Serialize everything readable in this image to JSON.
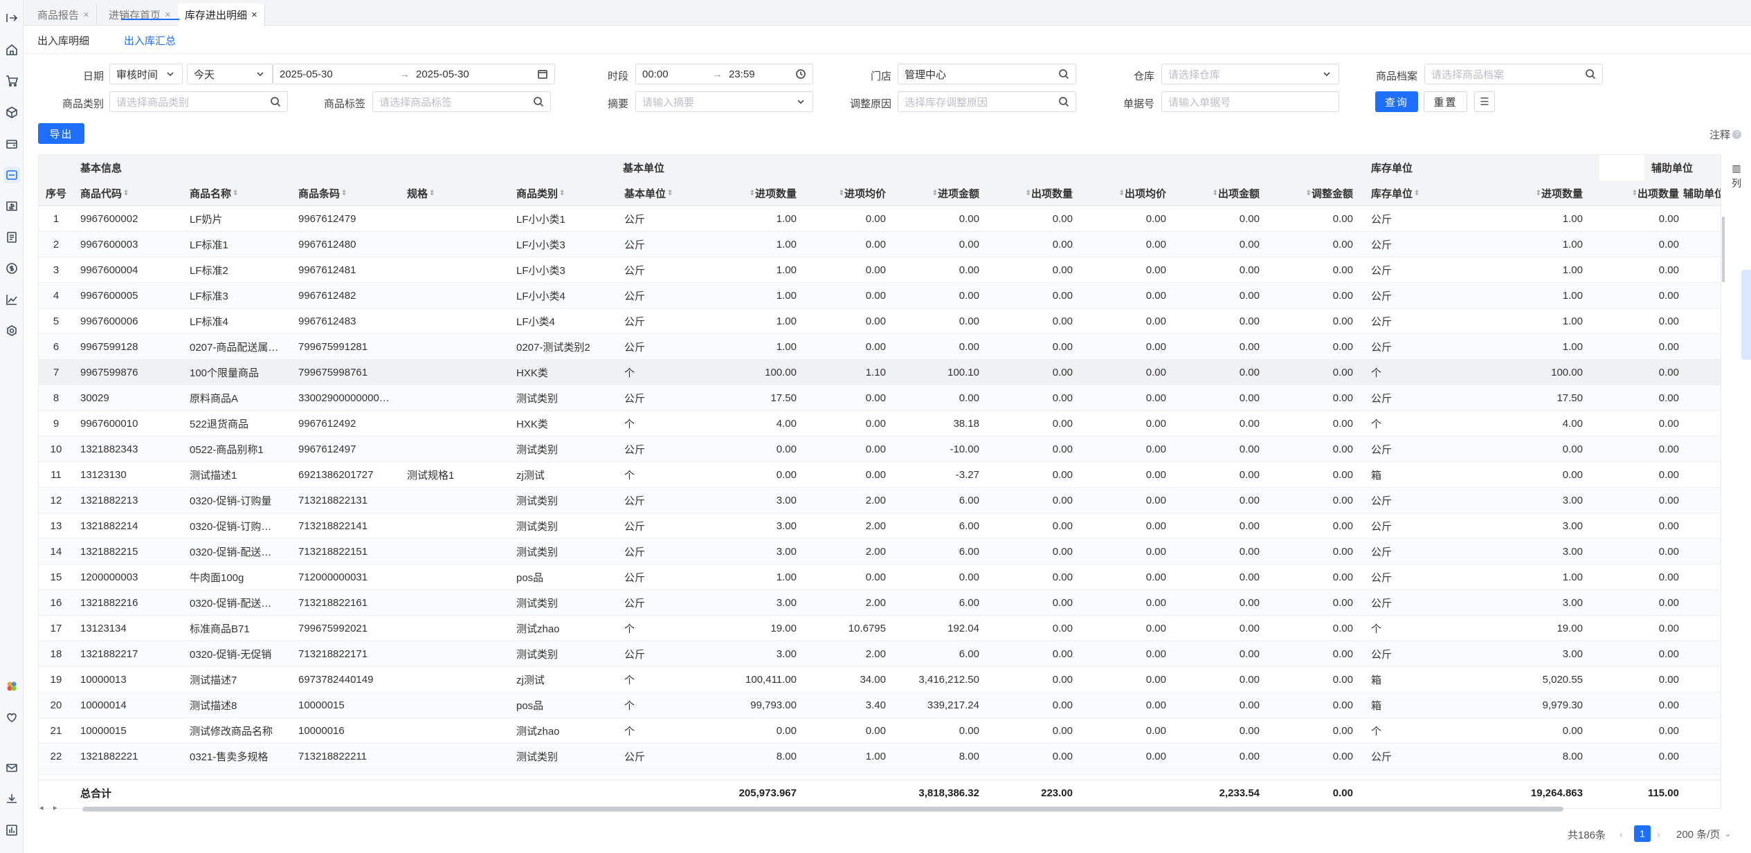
{
  "page_tabs": [
    {
      "label": "商品报告",
      "active": false
    },
    {
      "label": "进销存首页",
      "active": false
    },
    {
      "label": "库存进出明细",
      "active": true
    }
  ],
  "sub_tabs": [
    {
      "label": "出入库明细",
      "active": false
    },
    {
      "label": "出入库汇总",
      "active": true
    }
  ],
  "filters": {
    "date_label": "日期",
    "date_type": "审核时间",
    "date_range": "今天",
    "date_start": "2025-05-30",
    "date_end": "2025-05-30",
    "period_label": "时段",
    "time_start": "00:00",
    "time_end": "23:59",
    "store_label": "门店",
    "store_value": "管理中心",
    "warehouse_label": "仓库",
    "warehouse_placeholder": "请选择仓库",
    "product_file_label": "商品档案",
    "product_file_placeholder": "请选择商品档案",
    "category_label": "商品类别",
    "category_placeholder": "请选择商品类别",
    "tag_label": "商品标签",
    "tag_placeholder": "请选择商品标签",
    "summary_label": "摘要",
    "summary_placeholder": "请输入摘要",
    "reason_label": "调整原因",
    "reason_placeholder": "选择库存调整原因",
    "docno_label": "单据号",
    "docno_placeholder": "请输入单据号",
    "query_label": "查询",
    "reset_label": "重置"
  },
  "export_label": "导出",
  "note_label": "注释",
  "group_headers": {
    "basic_info": "基本信息",
    "basic_unit": "基本单位",
    "stock_unit": "库存单位",
    "aux_unit": "辅助单位"
  },
  "columns": [
    "序号",
    "商品代码",
    "商品名称",
    "商品条码",
    "规格",
    "商品类别",
    "基本单位",
    "进项数量",
    "进项均价",
    "进项金额",
    "出项数量",
    "出项均价",
    "出项金额",
    "调整金额",
    "库存单位",
    "进项数量",
    "出项数量",
    "辅助单位"
  ],
  "rows": [
    [
      "1",
      "9967600002",
      "LF奶片",
      "9967612479",
      "",
      "LF小小类1",
      "公斤",
      "1.00",
      "0.00",
      "0.00",
      "0.00",
      "0.00",
      "0.00",
      "0.00",
      "公斤",
      "1.00",
      "0.00",
      ""
    ],
    [
      "2",
      "9967600003",
      "LF标准1",
      "9967612480",
      "",
      "LF小小类3",
      "公斤",
      "1.00",
      "0.00",
      "0.00",
      "0.00",
      "0.00",
      "0.00",
      "0.00",
      "公斤",
      "1.00",
      "0.00",
      ""
    ],
    [
      "3",
      "9967600004",
      "LF标准2",
      "9967612481",
      "",
      "LF小小类3",
      "公斤",
      "1.00",
      "0.00",
      "0.00",
      "0.00",
      "0.00",
      "0.00",
      "0.00",
      "公斤",
      "1.00",
      "0.00",
      ""
    ],
    [
      "4",
      "9967600005",
      "LF标准3",
      "9967612482",
      "",
      "LF小小类4",
      "公斤",
      "1.00",
      "0.00",
      "0.00",
      "0.00",
      "0.00",
      "0.00",
      "0.00",
      "公斤",
      "1.00",
      "0.00",
      ""
    ],
    [
      "5",
      "9967600006",
      "LF标准4",
      "9967612483",
      "",
      "LF小类4",
      "公斤",
      "1.00",
      "0.00",
      "0.00",
      "0.00",
      "0.00",
      "0.00",
      "0.00",
      "公斤",
      "1.00",
      "0.00",
      ""
    ],
    [
      "6",
      "9967599128",
      "0207-商品配送属…",
      "799675991281",
      "",
      "0207-测试类别2",
      "公斤",
      "1.00",
      "0.00",
      "0.00",
      "0.00",
      "0.00",
      "0.00",
      "0.00",
      "公斤",
      "1.00",
      "0.00",
      ""
    ],
    [
      "7",
      "9967599876",
      "100个限量商品",
      "799675998761",
      "",
      "HXK类",
      "个",
      "100.00",
      "1.10",
      "100.10",
      "0.00",
      "0.00",
      "0.00",
      "0.00",
      "个",
      "100.00",
      "0.00",
      ""
    ],
    [
      "8",
      "30029",
      "原料商品A",
      "33002900000000…",
      "",
      "测试类别",
      "公斤",
      "17.50",
      "0.00",
      "0.00",
      "0.00",
      "0.00",
      "0.00",
      "0.00",
      "公斤",
      "17.50",
      "0.00",
      ""
    ],
    [
      "9",
      "9967600010",
      "522退货商品",
      "9967612492",
      "",
      "HXK类",
      "个",
      "4.00",
      "0.00",
      "38.18",
      "0.00",
      "0.00",
      "0.00",
      "0.00",
      "个",
      "4.00",
      "0.00",
      ""
    ],
    [
      "10",
      "1321882343",
      "0522-商品别称1",
      "9967612497",
      "",
      "测试类别",
      "公斤",
      "0.00",
      "0.00",
      "-10.00",
      "0.00",
      "0.00",
      "0.00",
      "0.00",
      "公斤",
      "0.00",
      "0.00",
      ""
    ],
    [
      "11",
      "13123130",
      "测试描述1",
      "6921386201727",
      "测试规格1",
      "zj测试",
      "个",
      "0.00",
      "0.00",
      "-3.27",
      "0.00",
      "0.00",
      "0.00",
      "0.00",
      "箱",
      "0.00",
      "0.00",
      ""
    ],
    [
      "12",
      "1321882213",
      "0320-促销-订购量",
      "713218822131",
      "",
      "测试类别",
      "公斤",
      "3.00",
      "2.00",
      "6.00",
      "0.00",
      "0.00",
      "0.00",
      "0.00",
      "公斤",
      "3.00",
      "0.00",
      ""
    ],
    [
      "13",
      "1321882214",
      "0320-促销-订购…",
      "713218822141",
      "",
      "测试类别",
      "公斤",
      "3.00",
      "2.00",
      "6.00",
      "0.00",
      "0.00",
      "0.00",
      "0.00",
      "公斤",
      "3.00",
      "0.00",
      ""
    ],
    [
      "14",
      "1321882215",
      "0320-促销-配送…",
      "713218822151",
      "",
      "测试类别",
      "公斤",
      "3.00",
      "2.00",
      "6.00",
      "0.00",
      "0.00",
      "0.00",
      "0.00",
      "公斤",
      "3.00",
      "0.00",
      ""
    ],
    [
      "15",
      "1200000003",
      "牛肉面100g",
      "712000000031",
      "",
      "pos品",
      "公斤",
      "1.00",
      "0.00",
      "0.00",
      "0.00",
      "0.00",
      "0.00",
      "0.00",
      "公斤",
      "1.00",
      "0.00",
      ""
    ],
    [
      "16",
      "1321882216",
      "0320-促销-配送…",
      "713218822161",
      "",
      "测试类别",
      "公斤",
      "3.00",
      "2.00",
      "6.00",
      "0.00",
      "0.00",
      "0.00",
      "0.00",
      "公斤",
      "3.00",
      "0.00",
      ""
    ],
    [
      "17",
      "13123134",
      "标准商品B71",
      "799675992021",
      "",
      "测试zhao",
      "个",
      "19.00",
      "10.6795",
      "192.04",
      "0.00",
      "0.00",
      "0.00",
      "0.00",
      "个",
      "19.00",
      "0.00",
      ""
    ],
    [
      "18",
      "1321882217",
      "0320-促销-无促销",
      "713218822171",
      "",
      "测试类别",
      "公斤",
      "3.00",
      "2.00",
      "6.00",
      "0.00",
      "0.00",
      "0.00",
      "0.00",
      "公斤",
      "3.00",
      "0.00",
      ""
    ],
    [
      "19",
      "10000013",
      "测试描述7",
      "6973782440149",
      "",
      "zj测试",
      "个",
      "100,411.00",
      "34.00",
      "3,416,212.50",
      "0.00",
      "0.00",
      "0.00",
      "0.00",
      "箱",
      "5,020.55",
      "0.00",
      ""
    ],
    [
      "20",
      "10000014",
      "测试描述8",
      "10000015",
      "",
      "pos品",
      "个",
      "99,793.00",
      "3.40",
      "339,217.24",
      "0.00",
      "0.00",
      "0.00",
      "0.00",
      "箱",
      "9,979.30",
      "0.00",
      ""
    ],
    [
      "21",
      "10000015",
      "测试修改商品名称",
      "10000016",
      "",
      "测试zhao",
      "个",
      "0.00",
      "0.00",
      "0.00",
      "0.00",
      "0.00",
      "0.00",
      "0.00",
      "个",
      "0.00",
      "0.00",
      ""
    ],
    [
      "22",
      "1321882221",
      "0321-售卖多规格",
      "713218822211",
      "",
      "测试类别",
      "公斤",
      "8.00",
      "1.00",
      "8.00",
      "0.00",
      "0.00",
      "0.00",
      "0.00",
      "公斤",
      "8.00",
      "0.00",
      ""
    ]
  ],
  "totals": {
    "label": "总合计",
    "in_qty": "205,973.967",
    "in_amount": "3,818,386.32",
    "out_qty": "223.00",
    "out_amount": "2,233.54",
    "adjust_amount": "0.00",
    "stock_in_qty": "19,264.863",
    "stock_out_qty": "115.00"
  },
  "column_panel_label": "列",
  "pagination": {
    "total": "共186条",
    "current_page": "1",
    "page_size": "200 条/页"
  },
  "colors": {
    "accent": "#1f6fff"
  },
  "sidebar_icons": [
    "collapse-icon",
    "home-icon",
    "cart-icon",
    "box-icon",
    "wallet-icon",
    "inventory-icon",
    "finance-icon",
    "document-icon",
    "dollar-icon",
    "chart-icon",
    "settings-icon",
    "apps-icon",
    "heart-icon",
    "mail-icon",
    "download-icon",
    "report-icon"
  ]
}
